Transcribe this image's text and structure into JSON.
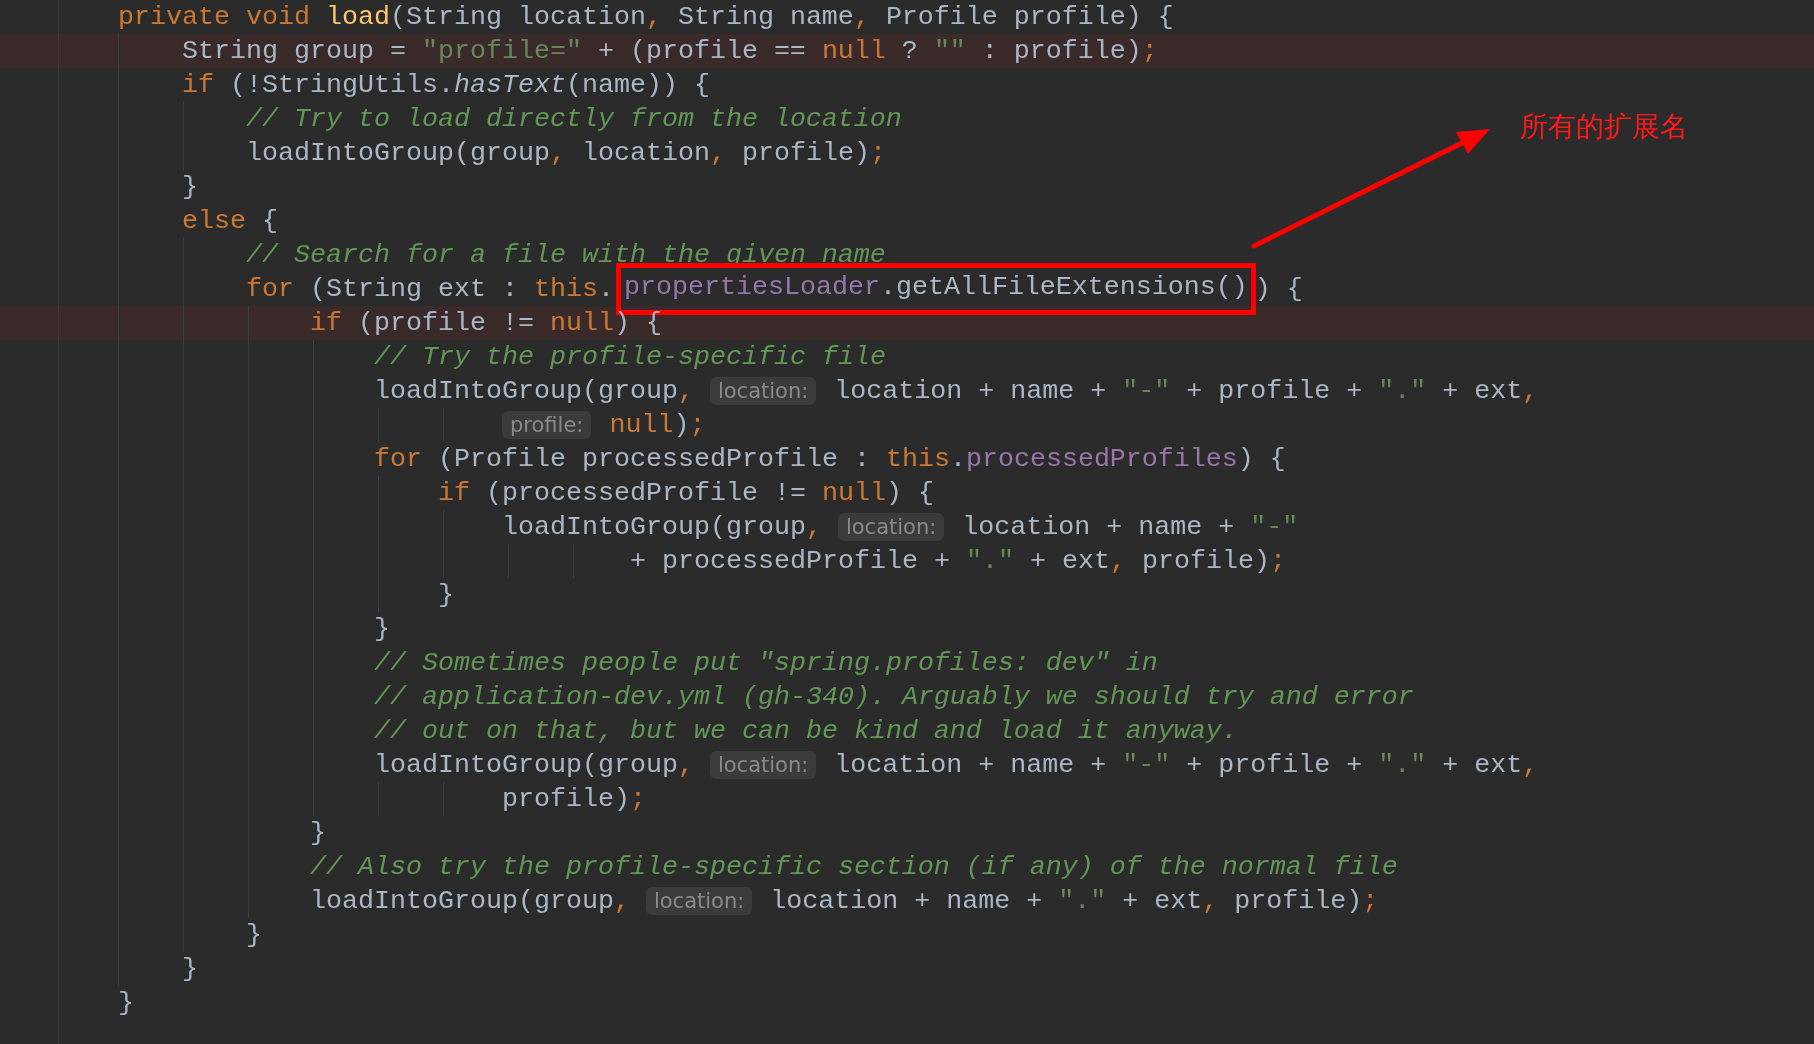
{
  "editor": {
    "lines": [
      {
        "highlighted": false,
        "tokens": [
          {
            "kind": "keyword",
            "text": "private void "
          },
          {
            "kind": "method",
            "text": "load"
          },
          {
            "kind": "plain",
            "text": "(String location"
          },
          {
            "kind": "keyword",
            "text": ", "
          },
          {
            "kind": "plain",
            "text": "String name"
          },
          {
            "kind": "keyword",
            "text": ", "
          },
          {
            "kind": "plain",
            "text": "Profile profile) {"
          }
        ],
        "children": [
          {
            "highlighted": true,
            "tokens": [
              {
                "kind": "plain",
                "text": "String group = "
              },
              {
                "kind": "string",
                "text": "\"profile=\""
              },
              {
                "kind": "plain",
                "text": " + (profile == "
              },
              {
                "kind": "keyword",
                "text": "null"
              },
              {
                "kind": "plain",
                "text": " ? "
              },
              {
                "kind": "string",
                "text": "\"\""
              },
              {
                "kind": "plain",
                "text": " : profile)"
              },
              {
                "kind": "keyword",
                "text": ";"
              }
            ]
          },
          {
            "highlighted": false,
            "tokens": [
              {
                "kind": "keyword",
                "text": "if "
              },
              {
                "kind": "plain",
                "text": "(!StringUtils."
              },
              {
                "kind": "static",
                "text": "hasText"
              },
              {
                "kind": "plain",
                "text": "(name)) {"
              }
            ],
            "children": [
              {
                "highlighted": false,
                "tokens": [
                  {
                    "kind": "comment",
                    "text": "// Try to load directly from the location"
                  }
                ]
              },
              {
                "highlighted": false,
                "tokens": [
                  {
                    "kind": "plain",
                    "text": "loadIntoGroup(group"
                  },
                  {
                    "kind": "keyword",
                    "text": ", "
                  },
                  {
                    "kind": "plain",
                    "text": "location"
                  },
                  {
                    "kind": "keyword",
                    "text": ", "
                  },
                  {
                    "kind": "plain",
                    "text": "profile)"
                  },
                  {
                    "kind": "keyword",
                    "text": ";"
                  }
                ]
              }
            ]
          },
          {
            "highlighted": false,
            "tokens": [
              {
                "kind": "plain",
                "text": "}"
              }
            ]
          },
          {
            "highlighted": false,
            "tokens": [
              {
                "kind": "keyword",
                "text": "else "
              },
              {
                "kind": "plain",
                "text": "{"
              }
            ],
            "children": [
              {
                "highlighted": false,
                "tokens": [
                  {
                    "kind": "comment",
                    "text": "// Search for a file with the given name"
                  }
                ]
              },
              {
                "highlighted": false,
                "tokens": [
                  {
                    "kind": "keyword",
                    "text": "for "
                  },
                  {
                    "kind": "plain",
                    "text": "(String ext : "
                  },
                  {
                    "kind": "keyword",
                    "text": "this"
                  },
                  {
                    "kind": "plain",
                    "text": "."
                  },
                  {
                    "kind": "boxed",
                    "tokens": [
                      {
                        "kind": "field",
                        "text": "propertiesLoader"
                      },
                      {
                        "kind": "plain",
                        "text": ".getAllFileExtensions()"
                      }
                    ]
                  },
                  {
                    "kind": "plain",
                    "text": ") {"
                  }
                ],
                "children": [
                  {
                    "highlighted": true,
                    "tokens": [
                      {
                        "kind": "keyword",
                        "text": "if "
                      },
                      {
                        "kind": "plain",
                        "text": "(profile != "
                      },
                      {
                        "kind": "keyword",
                        "text": "null"
                      },
                      {
                        "kind": "plain",
                        "text": ") {"
                      }
                    ],
                    "children": [
                      {
                        "highlighted": false,
                        "tokens": [
                          {
                            "kind": "comment",
                            "text": "// Try the profile-specific file"
                          }
                        ]
                      },
                      {
                        "highlighted": false,
                        "tokens": [
                          {
                            "kind": "plain",
                            "text": "loadIntoGroup(group"
                          },
                          {
                            "kind": "keyword",
                            "text": ", "
                          },
                          {
                            "kind": "hint",
                            "text": "location:"
                          },
                          {
                            "kind": "plain",
                            "text": " location + name + "
                          },
                          {
                            "kind": "string",
                            "text": "\"-\""
                          },
                          {
                            "kind": "plain",
                            "text": " + profile + "
                          },
                          {
                            "kind": "string",
                            "text": "\".\""
                          },
                          {
                            "kind": "plain",
                            "text": " + ext"
                          },
                          {
                            "kind": "keyword",
                            "text": ","
                          }
                        ],
                        "continuation": [
                          {
                            "highlighted": false,
                            "tokens": [
                              {
                                "kind": "hint",
                                "text": "profile:"
                              },
                              {
                                "kind": "keyword",
                                "text": " null"
                              },
                              {
                                "kind": "plain",
                                "text": ")"
                              },
                              {
                                "kind": "keyword",
                                "text": ";"
                              }
                            ]
                          }
                        ]
                      },
                      {
                        "highlighted": false,
                        "tokens": [
                          {
                            "kind": "keyword",
                            "text": "for "
                          },
                          {
                            "kind": "plain",
                            "text": "(Profile processedProfile : "
                          },
                          {
                            "kind": "keyword",
                            "text": "this"
                          },
                          {
                            "kind": "plain",
                            "text": "."
                          },
                          {
                            "kind": "field",
                            "text": "processedProfiles"
                          },
                          {
                            "kind": "plain",
                            "text": ") {"
                          }
                        ],
                        "children": [
                          {
                            "highlighted": false,
                            "tokens": [
                              {
                                "kind": "keyword",
                                "text": "if "
                              },
                              {
                                "kind": "plain",
                                "text": "(processedProfile != "
                              },
                              {
                                "kind": "keyword",
                                "text": "null"
                              },
                              {
                                "kind": "plain",
                                "text": ") {"
                              }
                            ],
                            "children": [
                              {
                                "highlighted": false,
                                "tokens": [
                                  {
                                    "kind": "plain",
                                    "text": "loadIntoGroup(group"
                                  },
                                  {
                                    "kind": "keyword",
                                    "text": ", "
                                  },
                                  {
                                    "kind": "hint",
                                    "text": "location:"
                                  },
                                  {
                                    "kind": "plain",
                                    "text": " location + name + "
                                  },
                                  {
                                    "kind": "string",
                                    "text": "\"-\""
                                  }
                                ],
                                "continuation": [
                                  {
                                    "highlighted": false,
                                    "tokens": [
                                      {
                                        "kind": "plain",
                                        "text": "+ processedProfile + "
                                      },
                                      {
                                        "kind": "string",
                                        "text": "\".\""
                                      },
                                      {
                                        "kind": "plain",
                                        "text": " + ext"
                                      },
                                      {
                                        "kind": "keyword",
                                        "text": ", "
                                      },
                                      {
                                        "kind": "plain",
                                        "text": "profile)"
                                      },
                                      {
                                        "kind": "keyword",
                                        "text": ";"
                                      }
                                    ]
                                  }
                                ]
                              }
                            ]
                          },
                          {
                            "highlighted": false,
                            "tokens": [
                              {
                                "kind": "plain",
                                "text": "}"
                              }
                            ]
                          }
                        ]
                      },
                      {
                        "highlighted": false,
                        "tokens": [
                          {
                            "kind": "plain",
                            "text": "}"
                          }
                        ]
                      },
                      {
                        "highlighted": false,
                        "tokens": [
                          {
                            "kind": "comment",
                            "text": "// Sometimes people put \"spring.profiles: dev\" in"
                          }
                        ]
                      },
                      {
                        "highlighted": false,
                        "tokens": [
                          {
                            "kind": "comment",
                            "text": "// application-dev.yml (gh-340). Arguably we should try and error"
                          }
                        ]
                      },
                      {
                        "highlighted": false,
                        "tokens": [
                          {
                            "kind": "comment",
                            "text": "// out on that, but we can be kind and load it anyway."
                          }
                        ]
                      },
                      {
                        "highlighted": false,
                        "tokens": [
                          {
                            "kind": "plain",
                            "text": "loadIntoGroup(group"
                          },
                          {
                            "kind": "keyword",
                            "text": ", "
                          },
                          {
                            "kind": "hint",
                            "text": "location:"
                          },
                          {
                            "kind": "plain",
                            "text": " location + name + "
                          },
                          {
                            "kind": "string",
                            "text": "\"-\""
                          },
                          {
                            "kind": "plain",
                            "text": " + profile + "
                          },
                          {
                            "kind": "string",
                            "text": "\".\""
                          },
                          {
                            "kind": "plain",
                            "text": " + ext"
                          },
                          {
                            "kind": "keyword",
                            "text": ","
                          }
                        ],
                        "continuation": [
                          {
                            "highlighted": false,
                            "tokens": [
                              {
                                "kind": "plain",
                                "text": "profile)"
                              },
                              {
                                "kind": "keyword",
                                "text": ";"
                              }
                            ]
                          }
                        ]
                      }
                    ]
                  },
                  {
                    "highlighted": false,
                    "tokens": [
                      {
                        "kind": "plain",
                        "text": "}"
                      }
                    ]
                  },
                  {
                    "highlighted": false,
                    "tokens": [
                      {
                        "kind": "comment",
                        "text": "// Also try the profile-specific section (if any) of the normal file"
                      }
                    ]
                  },
                  {
                    "highlighted": false,
                    "tokens": [
                      {
                        "kind": "plain",
                        "text": "loadIntoGroup(group"
                      },
                      {
                        "kind": "keyword",
                        "text": ", "
                      },
                      {
                        "kind": "hint",
                        "text": "location:"
                      },
                      {
                        "kind": "plain",
                        "text": " location + name + "
                      },
                      {
                        "kind": "string",
                        "text": "\".\""
                      },
                      {
                        "kind": "plain",
                        "text": " + ext"
                      },
                      {
                        "kind": "keyword",
                        "text": ", "
                      },
                      {
                        "kind": "plain",
                        "text": "profile)"
                      },
                      {
                        "kind": "keyword",
                        "text": ";"
                      }
                    ]
                  }
                ]
              },
              {
                "highlighted": false,
                "tokens": [
                  {
                    "kind": "plain",
                    "text": "}"
                  }
                ]
              }
            ]
          },
          {
            "highlighted": false,
            "tokens": [
              {
                "kind": "plain",
                "text": "}"
              }
            ]
          }
        ]
      },
      {
        "highlighted": false,
        "tokens": [
          {
            "kind": "plain",
            "text": "}"
          }
        ]
      }
    ]
  },
  "annotation": {
    "label": "所有的扩展名"
  }
}
